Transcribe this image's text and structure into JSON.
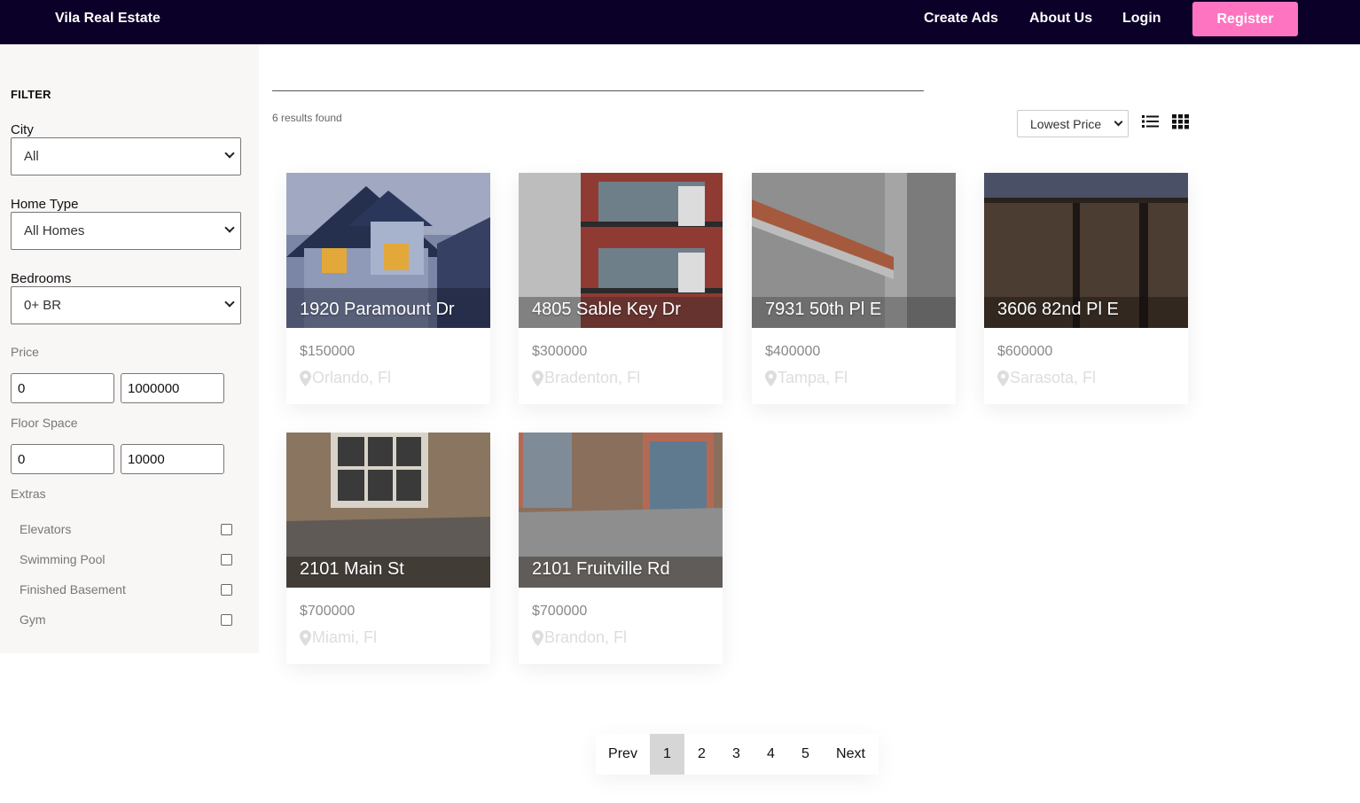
{
  "header": {
    "brand": "Vila Real Estate",
    "nav": {
      "create_ads": "Create Ads",
      "about_us": "About Us",
      "login": "Login"
    },
    "register": "Register",
    "colors": {
      "bar": "#0b0027",
      "register": "#ff74c1"
    }
  },
  "filter": {
    "title": "FILTER",
    "city": {
      "label": "City",
      "value": "All"
    },
    "home_type": {
      "label": "Home Type",
      "value": "All Homes"
    },
    "bedrooms": {
      "label": "Bedrooms",
      "value": "0+ BR"
    },
    "price": {
      "label": "Price",
      "min": "0",
      "max": "1000000"
    },
    "floor_space": {
      "label": "Floor Space",
      "min": "0",
      "max": "10000"
    },
    "extras": {
      "label": "Extras",
      "items": [
        {
          "label": "Elevators",
          "checked": false
        },
        {
          "label": "Swimming Pool",
          "checked": false
        },
        {
          "label": "Finished Basement",
          "checked": false
        },
        {
          "label": "Gym",
          "checked": false
        }
      ]
    }
  },
  "results": {
    "count_text": "6 results found",
    "sort_value": "Lowest Price",
    "view_icons": [
      "list-view-icon",
      "grid-view-icon"
    ]
  },
  "listings": [
    {
      "address": "1920 Paramount Dr",
      "price": "$150000",
      "location": "Orlando, Fl"
    },
    {
      "address": "4805 Sable Key Dr",
      "price": "$300000",
      "location": "Bradenton, Fl"
    },
    {
      "address": "7931 50th Pl E",
      "price": "$400000",
      "location": "Tampa, Fl"
    },
    {
      "address": "3606 82nd Pl E",
      "price": "$600000",
      "location": "Sarasota, Fl"
    },
    {
      "address": "2101 Main St",
      "price": "$700000",
      "location": "Miami, Fl"
    },
    {
      "address": "2101 Fruitville Rd",
      "price": "$700000",
      "location": "Brandon, Fl"
    }
  ],
  "pagination": {
    "prev": "Prev",
    "pages": [
      "1",
      "2",
      "3",
      "4",
      "5"
    ],
    "active": "1",
    "next": "Next"
  }
}
